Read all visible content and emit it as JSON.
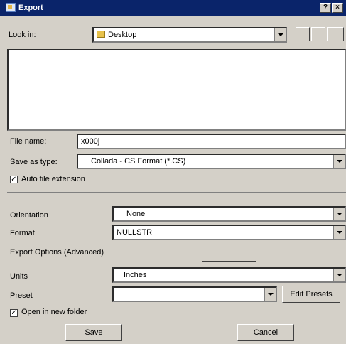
{
  "window": {
    "title": "Export",
    "help_btn": "?",
    "close_btn": "×"
  },
  "look_in": {
    "label": "Look in:",
    "value": "Desktop"
  },
  "file_name": {
    "label": "File name:",
    "value": "x000j"
  },
  "save_as_type": {
    "label": "Save as type:",
    "value": "Collada - CS Format (*.CS)"
  },
  "auto_extension": {
    "label": "Auto file extension",
    "checked": true
  },
  "orientation": {
    "label": "Orientation",
    "value": "None"
  },
  "format": {
    "label": "Format",
    "value": "NULLSTR"
  },
  "section_label": "Export Options (Advanced)",
  "units": {
    "label": "Units",
    "value": "Inches"
  },
  "preset": {
    "label": "Preset",
    "value": ""
  },
  "edit_button": "Edit Presets",
  "open_after": {
    "label": "Open in new folder",
    "checked": true
  },
  "save_button": "Save",
  "cancel_button": "Cancel",
  "icons": {
    "nav": [
      "up-folder-icon",
      "new-folder-icon",
      "view-menu-icon"
    ]
  }
}
